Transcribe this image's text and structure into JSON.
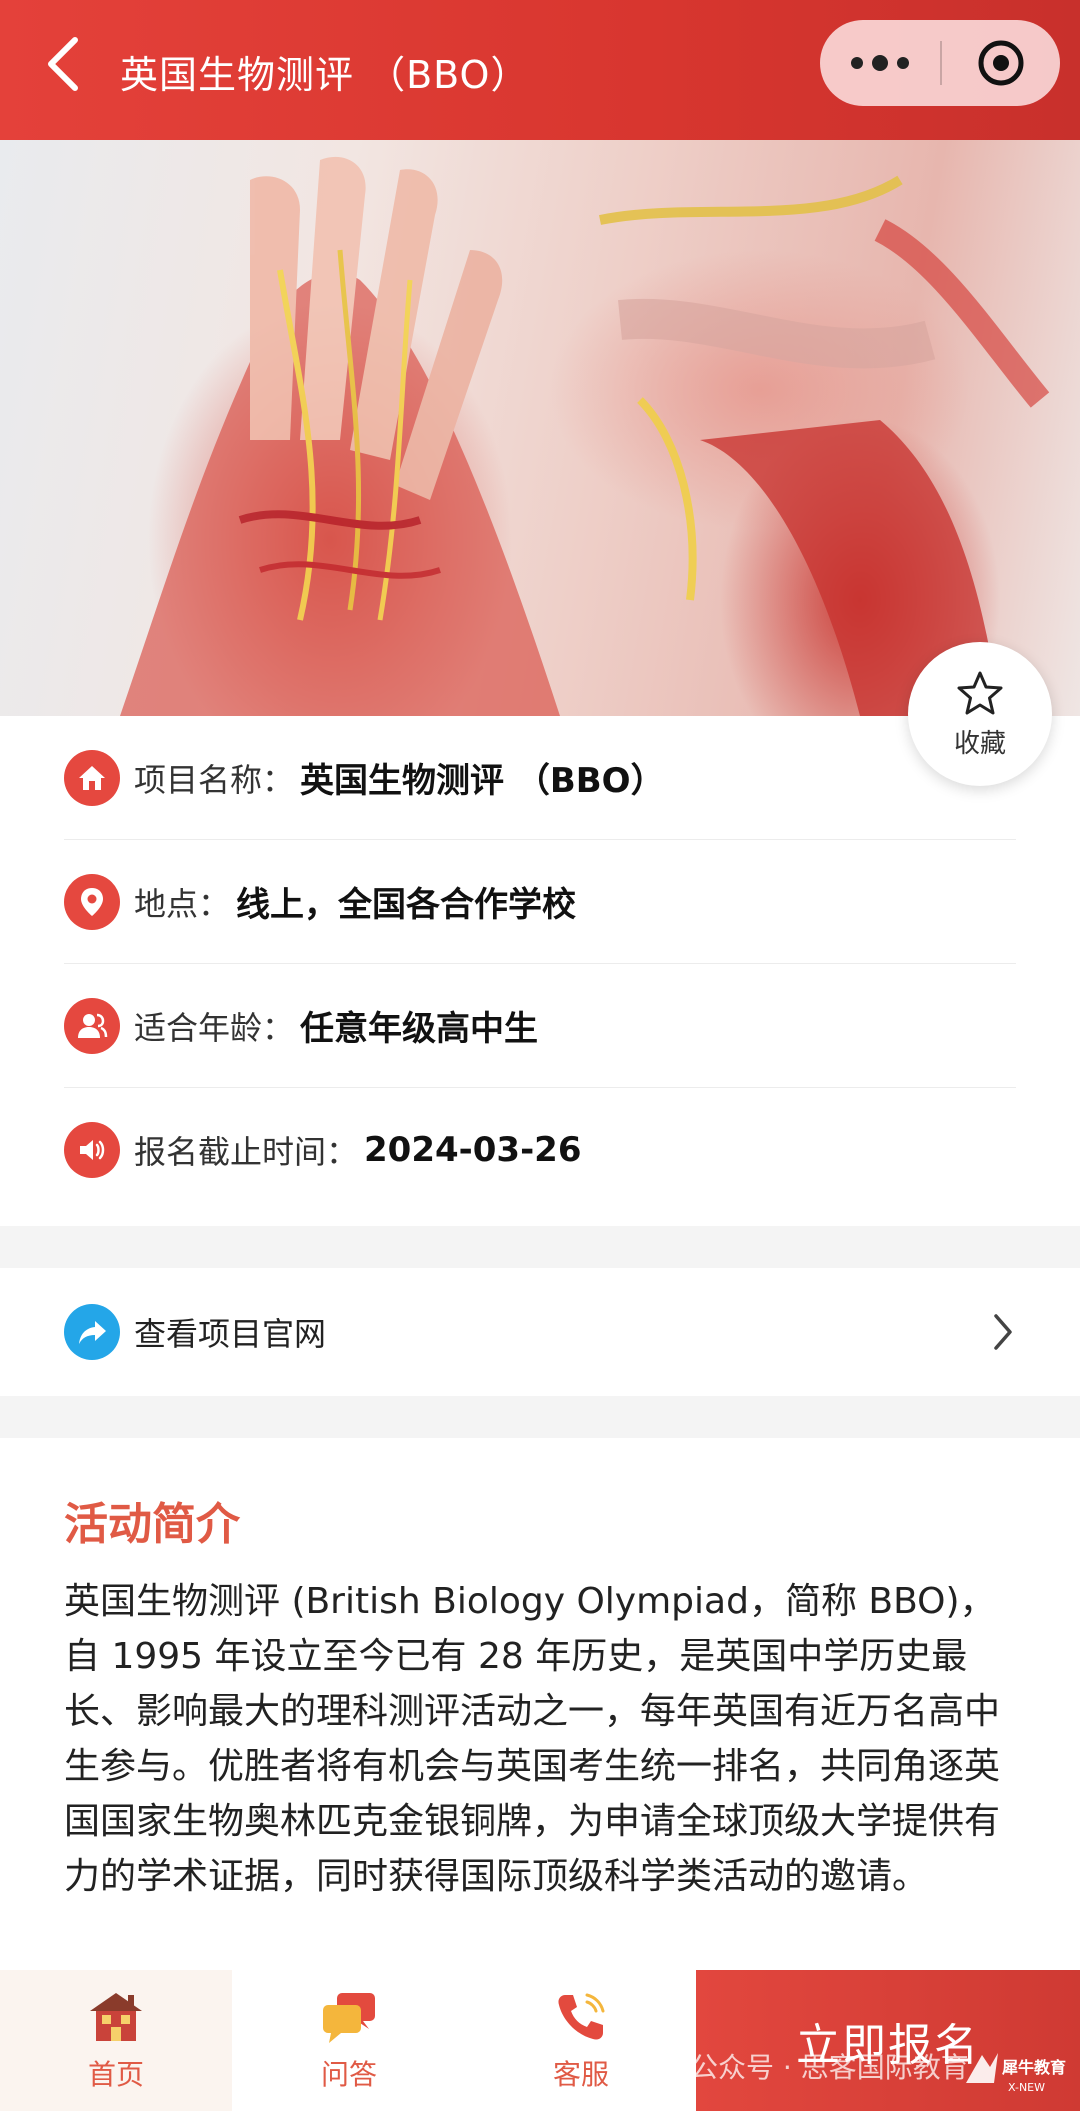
{
  "header": {
    "title": "英国生物测评 （BBO）"
  },
  "collect": {
    "label": "收藏"
  },
  "info": {
    "project_name_label": "项目名称：",
    "project_name_value": "英国生物测评 （BBO）",
    "location_label": "地点：",
    "location_value": "线上，全国各合作学校",
    "age_label": "适合年龄：",
    "age_value": "任意年级高中生",
    "deadline_label": "报名截止时间：",
    "deadline_value": "2024-03-26"
  },
  "link": {
    "label": "查看项目官网"
  },
  "intro": {
    "title": "活动简介",
    "text": "英国生物测评 (British Biology Olympiad，简称 BBO)，自 1995 年设立至今已有 28 年历史，是英国中学历史最长、影响最大的理科测评活动之一，每年英国有近万名高中生参与。优胜者将有机会与英国考生统一排名，共同角逐英国国家生物奥林匹克金银铜牌，为申请全球顶级大学提供有力的学术证据，同时获得国际顶级科学类活动的邀请。"
  },
  "bottombar": {
    "home": "首页",
    "qa": "问答",
    "service": "客服",
    "signup": "立即报名"
  },
  "watermark": "公众号 · 思客国际教育",
  "brand_logo_text": "犀牛教育"
}
